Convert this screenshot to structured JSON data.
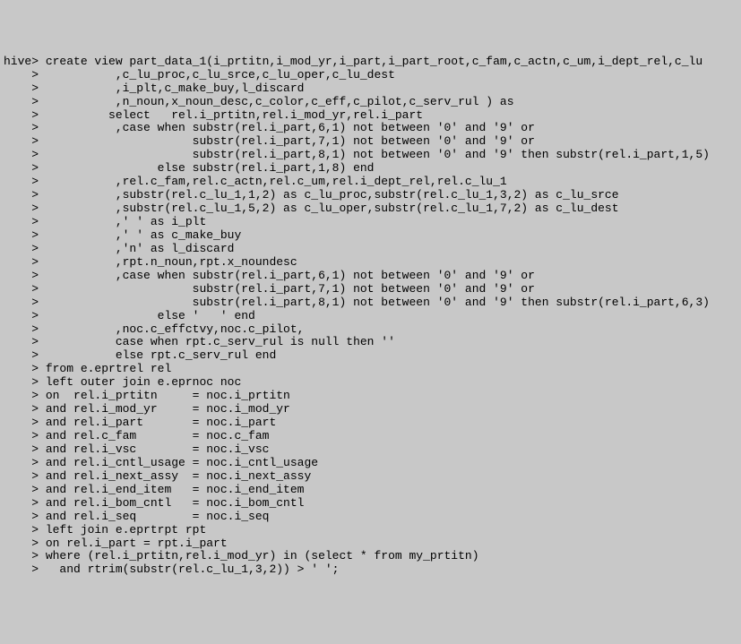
{
  "terminal": {
    "prompt_first": "hive>",
    "prompt_cont": "    >",
    "lines": [
      " create view part_data_1(i_prtitn,i_mod_yr,i_part,i_part_root,c_fam,c_actn,c_um,i_dept_rel,c_lu",
      "           ,c_lu_proc,c_lu_srce,c_lu_oper,c_lu_dest",
      "           ,i_plt,c_make_buy,l_discard",
      "           ,n_noun,x_noun_desc,c_color,c_eff,c_pilot,c_serv_rul ) as",
      "          select   rel.i_prtitn,rel.i_mod_yr,rel.i_part",
      "           ,case when substr(rel.i_part,6,1) not between '0' and '9' or",
      "                      substr(rel.i_part,7,1) not between '0' and '9' or",
      "                      substr(rel.i_part,8,1) not between '0' and '9' then substr(rel.i_part,1,5)",
      "                 else substr(rel.i_part,1,8) end",
      "           ,rel.c_fam,rel.c_actn,rel.c_um,rel.i_dept_rel,rel.c_lu_1",
      "           ,substr(rel.c_lu_1,1,2) as c_lu_proc,substr(rel.c_lu_1,3,2) as c_lu_srce",
      "           ,substr(rel.c_lu_1,5,2) as c_lu_oper,substr(rel.c_lu_1,7,2) as c_lu_dest",
      "           ,' ' as i_plt",
      "           ,' ' as c_make_buy",
      "           ,'n' as l_discard",
      "           ,rpt.n_noun,rpt.x_noundesc",
      "           ,case when substr(rel.i_part,6,1) not between '0' and '9' or",
      "                      substr(rel.i_part,7,1) not between '0' and '9' or",
      "                      substr(rel.i_part,8,1) not between '0' and '9' then substr(rel.i_part,6,3)",
      "                 else '   ' end",
      "           ,noc.c_effctvy,noc.c_pilot,",
      "           case when rpt.c_serv_rul is null then ''",
      "           else rpt.c_serv_rul end",
      " from e.eprtrel rel",
      " left outer join e.eprnoc noc",
      " on  rel.i_prtitn     = noc.i_prtitn",
      " and rel.i_mod_yr     = noc.i_mod_yr",
      " and rel.i_part       = noc.i_part",
      " and rel.c_fam        = noc.c_fam",
      " and rel.i_vsc        = noc.i_vsc",
      " and rel.i_cntl_usage = noc.i_cntl_usage",
      " and rel.i_next_assy  = noc.i_next_assy",
      " and rel.i_end_item   = noc.i_end_item",
      " and rel.i_bom_cntl   = noc.i_bom_cntl",
      " and rel.i_seq        = noc.i_seq",
      " left join e.eprtrpt rpt",
      " on rel.i_part = rpt.i_part",
      " where (rel.i_prtitn,rel.i_mod_yr) in (select * from my_prtitn)",
      "   and rtrim(substr(rel.c_lu_1,3,2)) > ' ';"
    ]
  }
}
